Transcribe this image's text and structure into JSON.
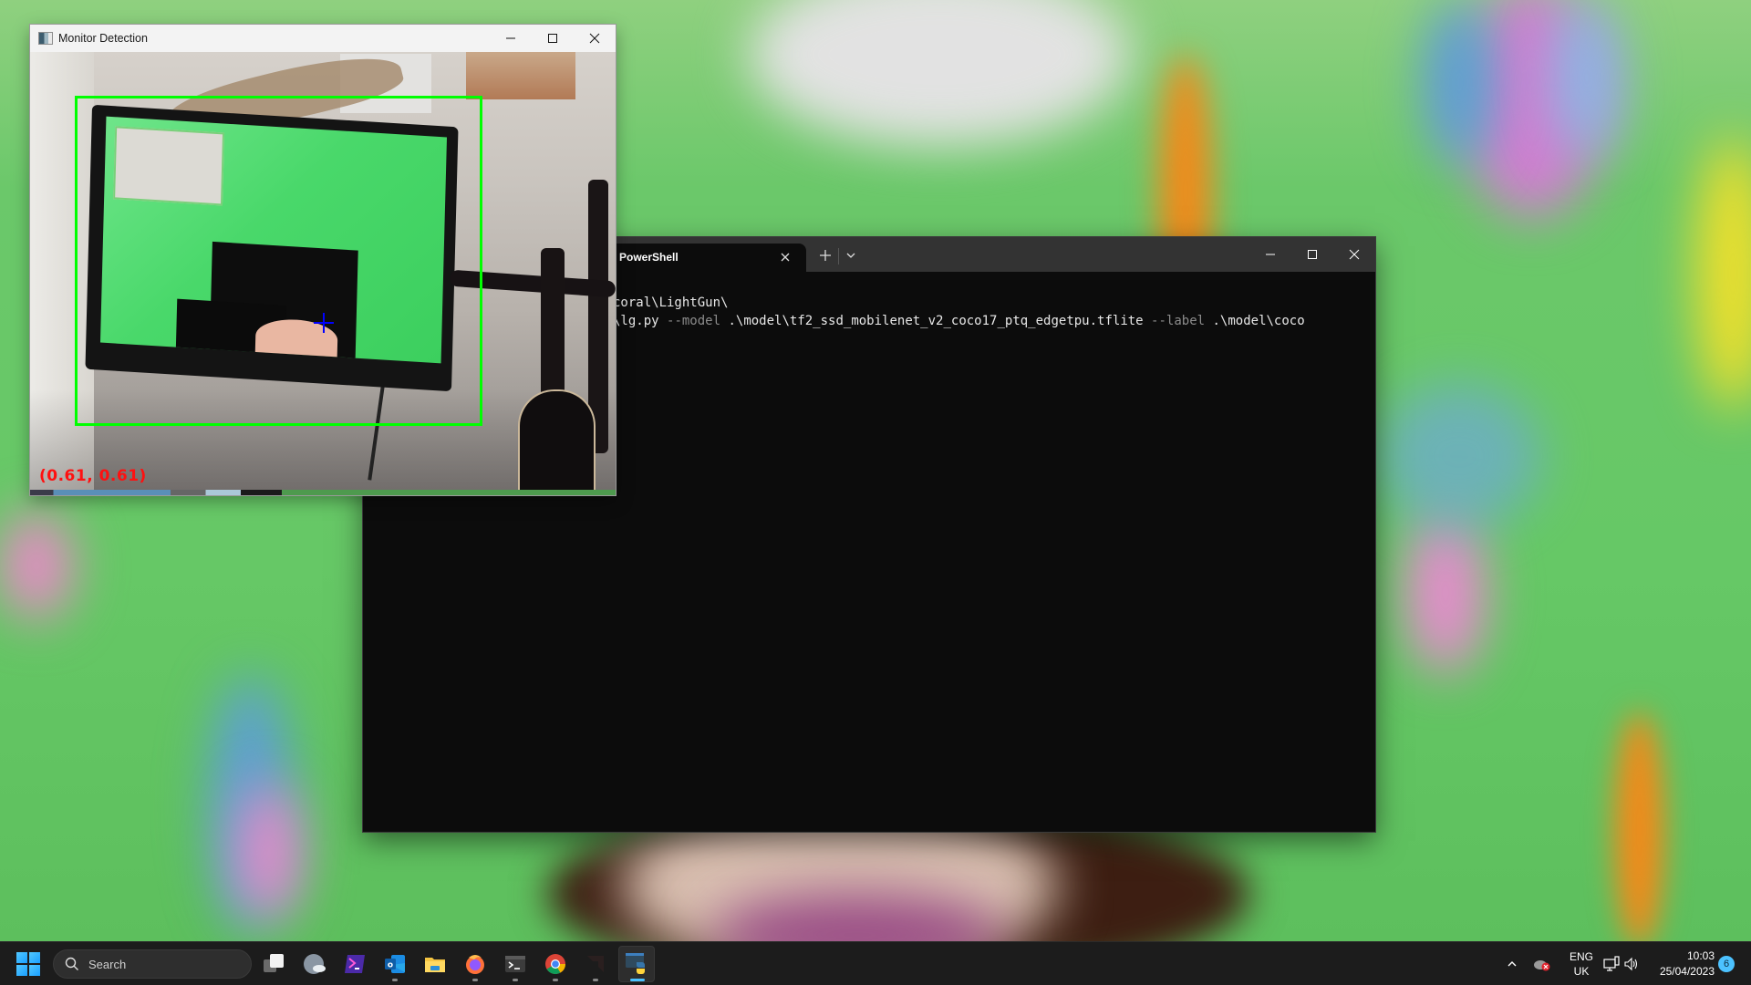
{
  "camera_window": {
    "title": "Monitor Detection",
    "icon": "opencv-window-icon",
    "controls": [
      "minimize",
      "maximize",
      "close"
    ],
    "overlay": {
      "detection_label": "monitor",
      "detection_box_color": "#00ff00",
      "crosshair_color": "#0000ff",
      "coords_text": "(0.61, 0.61)",
      "coords_color": "#ff0000"
    }
  },
  "terminal": {
    "tab_title": "PowerShell",
    "new_tab_icon": "plus-icon",
    "dropdown_icon": "chevron-down-icon",
    "controls": [
      "minimize",
      "maximize",
      "close"
    ],
    "lines": [
      {
        "segments": [
          {
            "text": "coral\\LightGun\\",
            "style": "normal"
          }
        ]
      },
      {
        "segments": [
          {
            "text": "\\lg.py ",
            "style": "normal"
          },
          {
            "text": "--model",
            "style": "flag"
          },
          {
            "text": " .\\model\\tf2_ssd_mobilenet_v2_coco17_ptq_edgetpu.tflite ",
            "style": "normal"
          },
          {
            "text": "--label",
            "style": "flag"
          },
          {
            "text": " .\\model\\coco",
            "style": "normal"
          }
        ]
      }
    ]
  },
  "taskbar": {
    "search_label": "Search",
    "apps": [
      {
        "name": "task-view",
        "running": false,
        "active": false
      },
      {
        "name": "widgets",
        "running": false,
        "active": false
      },
      {
        "name": "powershell-ise",
        "running": false,
        "active": false
      },
      {
        "name": "outlook",
        "running": true,
        "active": false
      },
      {
        "name": "file-explorer",
        "running": false,
        "active": false
      },
      {
        "name": "firefox",
        "running": true,
        "active": false
      },
      {
        "name": "windows-terminal",
        "running": true,
        "active": false
      },
      {
        "name": "chrome",
        "running": true,
        "active": false
      },
      {
        "name": "amd-software",
        "running": true,
        "active": false
      },
      {
        "name": "python",
        "running": true,
        "active": true
      }
    ],
    "tray": {
      "language_line1": "ENG",
      "language_line2": "UK",
      "time": "10:03",
      "date": "25/04/2023",
      "notification_count": "6"
    }
  },
  "colors": {
    "accent": "#4cc2ff",
    "terminal_bg": "#0c0c0c",
    "terminal_titlebar": "#333333",
    "taskbar_bg": "#1c1c1c"
  }
}
